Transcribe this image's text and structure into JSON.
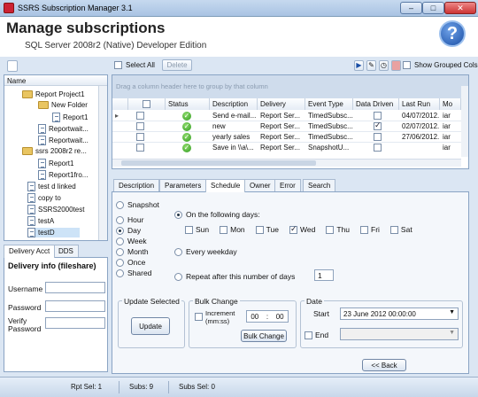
{
  "window": {
    "title": "SSRS Subscription Manager 3.1",
    "buttons": [
      "–",
      "□",
      "✕"
    ]
  },
  "header": {
    "title": "Manage subscriptions",
    "subtitle": "SQL Server 2008r2 (Native) Developer Edition",
    "help": "?"
  },
  "toolbar": {
    "select_all": "Select All",
    "delete": "Delete",
    "show_grouped": "Show Grouped Cols"
  },
  "tree": {
    "header": "Name",
    "items": [
      "Report Project1",
      "New Folder",
      "Report1",
      "Reportwait...",
      "Reportwait...",
      "ssrs 2008r2  re...",
      "Report1",
      "Report1fro...",
      "test d linked",
      "copy to",
      "SSRS2000test",
      "testA",
      "testD"
    ]
  },
  "left_tabs": [
    "Delivery Acct",
    "DDS"
  ],
  "delivery": {
    "title": "Delivery info (fileshare)",
    "username": "Username",
    "password": "Password",
    "verify": "Verify Password"
  },
  "grid": {
    "group_hint": "Drag a column header here to group by that column",
    "columns": [
      "",
      "Status",
      "Description",
      "Delivery",
      "Event Type",
      "Data Driven",
      "Last Run",
      "Mo"
    ],
    "rows": [
      {
        "desc": "Send e-mail...",
        "delivery": "Report Ser...",
        "event": "TimedSubsc...",
        "dd": false,
        "last": "04/07/2012...",
        "mo": "iar"
      },
      {
        "desc": "new",
        "delivery": "Report Ser...",
        "event": "TimedSubsc...",
        "dd": true,
        "last": "02/07/2012...",
        "mo": "iar"
      },
      {
        "desc": "yearly sales",
        "delivery": "Report Ser...",
        "event": "TimedSubsc...",
        "dd": false,
        "last": "27/06/2012...",
        "mo": "iar"
      },
      {
        "desc": "Save in \\\\a\\...",
        "delivery": "Report Ser...",
        "event": "SnapshotU...",
        "dd": false,
        "last": "",
        "mo": "iar"
      }
    ]
  },
  "tabs": [
    "Description",
    "Parameters",
    "Schedule",
    "Owner",
    "Error",
    "Search"
  ],
  "schedule": {
    "types": [
      "Snapshot",
      "Hour",
      "Day",
      "Week",
      "Month",
      "Once",
      "Shared"
    ],
    "selected_type": "Day",
    "on_days": "On the following days:",
    "days": [
      {
        "d": "Sun",
        "on": false
      },
      {
        "d": "Mon",
        "on": false
      },
      {
        "d": "Tue",
        "on": false
      },
      {
        "d": "Wed",
        "on": true
      },
      {
        "d": "Thu",
        "on": false
      },
      {
        "d": "Fri",
        "on": false
      },
      {
        "d": "Sat",
        "on": false
      }
    ],
    "every_weekday": "Every weekday",
    "repeat": "Repeat after this number of days",
    "repeat_value": "1"
  },
  "update": {
    "group": "Update Selected",
    "button": "Update"
  },
  "bulk": {
    "group": "Bulk Change",
    "increment": "Increment (mm:ss)",
    "h": "00",
    "m": "00",
    "button": "Bulk Change"
  },
  "date": {
    "group": "Date",
    "start_label": "Start",
    "start_value": "23 June 2012 00:00:00",
    "end_label": "End"
  },
  "back": "<< Back",
  "status": {
    "rpt": "Rpt Sel: 1",
    "subs": "Subs: 9",
    "subs_sel": "Subs Sel: 0"
  }
}
